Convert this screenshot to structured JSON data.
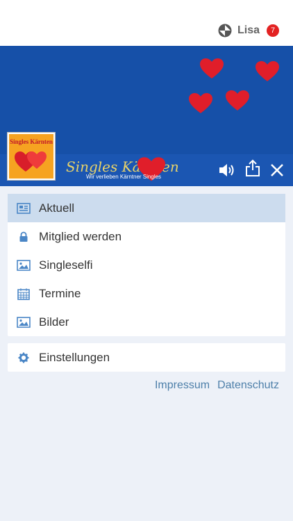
{
  "user": {
    "name": "Lisa",
    "badge_count": "7"
  },
  "logo": {
    "badge_text": "Singles Kärnten",
    "title": "Singles Kärnten",
    "subtitle": "Wir verlieben Kärntner Singles"
  },
  "menu": [
    {
      "label": "Aktuell",
      "icon": "newspaper-icon",
      "active": true
    },
    {
      "label": "Mitglied werden",
      "icon": "lock-icon",
      "active": false
    },
    {
      "label": "Singleselfi",
      "icon": "image-icon",
      "active": false
    },
    {
      "label": "Termine",
      "icon": "calendar-icon",
      "active": false
    },
    {
      "label": "Bilder",
      "icon": "image-icon",
      "active": false
    }
  ],
  "settings": {
    "label": "Einstellungen",
    "icon": "gear-icon"
  },
  "footer": {
    "impressum": "Impressum",
    "datenschutz": "Datenschutz"
  },
  "colors": {
    "accent": "#1650a8",
    "active_item": "#ccdcee",
    "icon": "#4a86c6",
    "link": "#4d7fa9",
    "badge": "#e32222"
  }
}
